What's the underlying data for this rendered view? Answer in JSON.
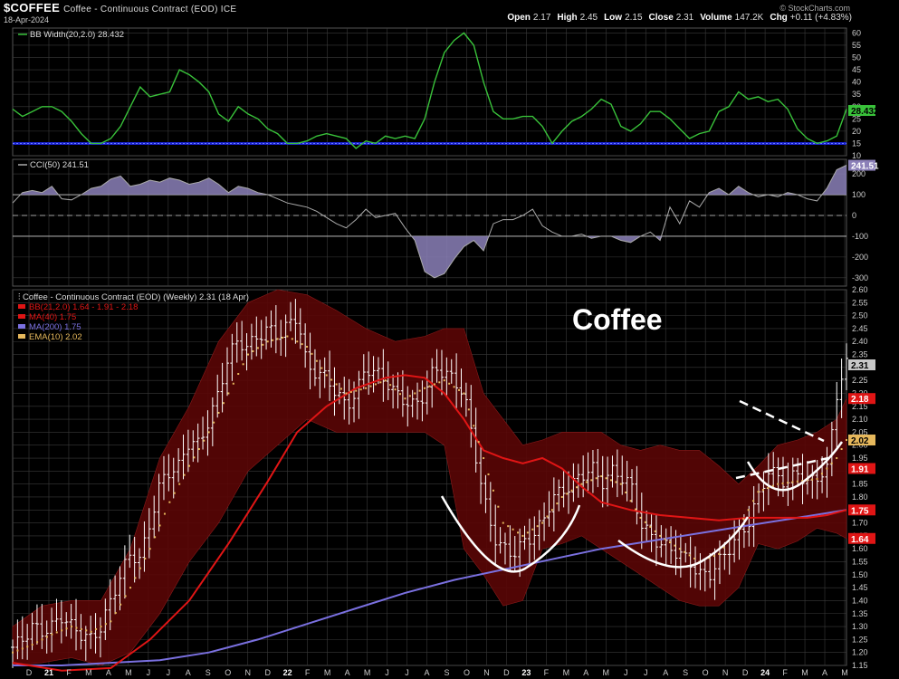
{
  "header": {
    "symbol": "$COFFEE",
    "description": "Coffee - Continuous Contract (EOD) ICE",
    "date": "18-Apr-2024",
    "copyright": "© StockCharts.com",
    "ohlc": [
      {
        "label": "Open",
        "value": "2.17"
      },
      {
        "label": "High",
        "value": "2.45"
      },
      {
        "label": "Low",
        "value": "2.15"
      },
      {
        "label": "Close",
        "value": "2.31"
      },
      {
        "label": "Volume",
        "value": "147.2K"
      },
      {
        "label": "Chg",
        "value": "+0.11 (+4.83%)"
      }
    ]
  },
  "colors": {
    "background": "#000000",
    "grid": "#3a3a3a",
    "bbwidth": "#39c23a",
    "bbwidth_ref": "#1a22cc",
    "cci_line": "#aaaaaa",
    "cci_fill": "#8b80b8",
    "band_fill": "#5a0505",
    "ma40": "#e01515",
    "ma200": "#7a70e0",
    "ema10": "#e6b85c",
    "bars": "#ffffff",
    "annot": "#ffffff",
    "label_box": "#c8c8c8"
  },
  "chart_data": [
    {
      "type": "line",
      "title": "BB Width(20,2.0) 28.432",
      "current_label": "28.432",
      "ylim": [
        10,
        62
      ],
      "yticks": [
        "10",
        "15",
        "20",
        "25",
        "30",
        "35",
        "40",
        "45",
        "50",
        "55",
        "60"
      ],
      "reference_line": 15,
      "x": [
        0,
        2,
        4,
        6,
        8,
        10,
        12,
        14,
        16,
        18,
        20,
        22,
        24,
        26,
        28,
        30,
        32,
        34,
        36,
        38,
        40,
        42,
        44,
        46,
        48,
        50,
        52,
        54,
        56,
        58,
        60,
        62,
        64,
        66,
        68,
        70,
        72,
        74,
        76,
        78,
        80,
        82,
        84,
        86,
        88,
        90,
        92,
        94,
        96,
        98,
        100,
        102,
        104,
        106,
        108,
        110,
        112,
        114,
        116,
        118,
        120,
        122,
        124,
        126,
        128,
        130,
        132,
        134,
        136,
        138,
        140,
        142,
        144,
        146,
        148,
        150,
        152,
        154,
        156,
        158,
        160,
        162,
        164,
        166,
        168,
        170
      ],
      "values": [
        29,
        26,
        28,
        30,
        30,
        28,
        24,
        19,
        15,
        15,
        17,
        22,
        30,
        38,
        34,
        35,
        36,
        45,
        43,
        40,
        36,
        27,
        24,
        30,
        27,
        25,
        21,
        19,
        15,
        15,
        16,
        18,
        19,
        18,
        17,
        13,
        16,
        15,
        18,
        17,
        18,
        17,
        25,
        40,
        52,
        57,
        60,
        55,
        40,
        28,
        25,
        25,
        26,
        26,
        22,
        15,
        20,
        24,
        26,
        29,
        33,
        31,
        22,
        20,
        23,
        28,
        28,
        25,
        21,
        17,
        19,
        20,
        28,
        30,
        36,
        33,
        34,
        32,
        33,
        29,
        21,
        17,
        15,
        16,
        18,
        29
      ],
      "series": [
        {
          "name": "BB Width(20,2.0)"
        }
      ]
    },
    {
      "type": "line",
      "title": "CCI(50) 241.51",
      "current_label": "241.51",
      "ylim": [
        -340,
        270
      ],
      "yticks": [
        "-300",
        "-200",
        "-100",
        "0",
        "100",
        "200"
      ],
      "hlines": [
        100,
        0,
        -100
      ],
      "x": [
        0,
        2,
        4,
        6,
        8,
        10,
        12,
        14,
        16,
        18,
        20,
        22,
        24,
        26,
        28,
        30,
        32,
        34,
        36,
        38,
        40,
        42,
        44,
        46,
        48,
        50,
        52,
        54,
        56,
        58,
        60,
        62,
        64,
        66,
        68,
        70,
        72,
        74,
        76,
        78,
        80,
        82,
        84,
        86,
        88,
        90,
        92,
        94,
        96,
        98,
        100,
        102,
        104,
        106,
        108,
        110,
        112,
        114,
        116,
        118,
        120,
        122,
        124,
        126,
        128,
        130,
        132,
        134,
        136,
        138,
        140,
        142,
        144,
        146,
        148,
        150,
        152,
        154,
        156,
        158,
        160,
        162,
        164,
        166,
        168,
        170
      ],
      "values": [
        60,
        110,
        120,
        110,
        140,
        80,
        75,
        100,
        130,
        140,
        175,
        190,
        140,
        150,
        170,
        160,
        180,
        170,
        150,
        160,
        180,
        150,
        110,
        140,
        130,
        110,
        100,
        80,
        60,
        50,
        40,
        20,
        -10,
        -40,
        -60,
        -20,
        30,
        -10,
        0,
        10,
        -60,
        -120,
        -270,
        -300,
        -280,
        -210,
        -150,
        -120,
        -170,
        -40,
        -20,
        -20,
        0,
        30,
        -50,
        -80,
        -100,
        -100,
        -90,
        -110,
        -100,
        -100,
        -120,
        -130,
        -100,
        -80,
        -120,
        40,
        -40,
        70,
        40,
        110,
        130,
        100,
        140,
        110,
        90,
        100,
        90,
        110,
        100,
        80,
        70,
        130,
        220,
        241.51
      ],
      "series": [
        {
          "name": "CCI(50)"
        }
      ]
    },
    {
      "type": "candlestick",
      "title": "Coffee - Continuous Contract (EOD) (Weekly) 2.31 (18 Apr)",
      "annotation": "Coffee",
      "ylim": [
        1.15,
        2.6
      ],
      "yticks": [
        "1.15",
        "1.20",
        "1.25",
        "1.30",
        "1.35",
        "1.40",
        "1.45",
        "1.50",
        "1.55",
        "1.60",
        "1.65",
        "1.70",
        "1.75",
        "1.80",
        "1.85",
        "1.90",
        "1.95",
        "2.00",
        "2.05",
        "2.10",
        "2.15",
        "2.20",
        "2.25",
        "2.30",
        "2.35",
        "2.40",
        "2.45",
        "2.50",
        "2.55",
        "2.60"
      ],
      "xticks": [
        "D",
        "21",
        "F",
        "M",
        "A",
        "M",
        "J",
        "J",
        "A",
        "S",
        "O",
        "N",
        "D",
        "22",
        "F",
        "M",
        "A",
        "M",
        "J",
        "J",
        "A",
        "S",
        "O",
        "N",
        "D",
        "23",
        "F",
        "M",
        "A",
        "M",
        "J",
        "J",
        "A",
        "S",
        "O",
        "N",
        "D",
        "24",
        "F",
        "M",
        "A",
        "M"
      ],
      "legend": [
        {
          "name": "BB(21,2.0)",
          "value": "1.64 - 1.91 - 2.18",
          "color": "#e01515"
        },
        {
          "name": "MA(40)",
          "value": "1.75",
          "color": "#e01515"
        },
        {
          "name": "MA(200)",
          "value": "1.75",
          "color": "#7a70e0"
        },
        {
          "name": "EMA(10)",
          "value": "2.02",
          "color": "#e6b85c"
        }
      ],
      "right_labels": [
        {
          "text": "2.31",
          "value": 2.31,
          "color": "#c8c8c8"
        },
        {
          "text": "2.18",
          "value": 2.18,
          "color": "#e01515"
        },
        {
          "text": "2.02",
          "value": 2.02,
          "color": "#e6b85c"
        },
        {
          "text": "1.91",
          "value": 1.91,
          "color": "#e01515"
        },
        {
          "text": "1.75",
          "value": 1.75,
          "color": "#e01515"
        },
        {
          "text": "1.64",
          "value": 1.64,
          "color": "#e01515"
        }
      ],
      "close": {
        "x": [
          0,
          2,
          4,
          6,
          8,
          10,
          12,
          14,
          16,
          18,
          20,
          22,
          24,
          26,
          28,
          30,
          32,
          34,
          36,
          38,
          40,
          42,
          44,
          46,
          48,
          50,
          52,
          54,
          56,
          58,
          60,
          62,
          64,
          66,
          68,
          70,
          72,
          74,
          76,
          78,
          80,
          82,
          84,
          86,
          88,
          90,
          92,
          94,
          96,
          98,
          100,
          102,
          104,
          106,
          108,
          110,
          112,
          114,
          116,
          118,
          120,
          122,
          124,
          126,
          128,
          130,
          132,
          134,
          136,
          138,
          140,
          142,
          144,
          146,
          148,
          150,
          152,
          154,
          156,
          158,
          160,
          162,
          164,
          166,
          168,
          170
        ],
        "values": [
          1.22,
          1.25,
          1.3,
          1.28,
          1.3,
          1.34,
          1.3,
          1.27,
          1.25,
          1.3,
          1.4,
          1.5,
          1.58,
          1.56,
          1.7,
          1.85,
          1.9,
          1.92,
          2.02,
          2.0,
          2.1,
          2.2,
          2.35,
          2.4,
          2.38,
          2.42,
          2.45,
          2.42,
          2.46,
          2.5,
          2.3,
          2.28,
          2.26,
          2.2,
          2.15,
          2.2,
          2.3,
          2.28,
          2.25,
          2.2,
          2.17,
          2.15,
          2.2,
          2.3,
          2.28,
          2.25,
          2.2,
          2.0,
          1.8,
          1.65,
          1.6,
          1.58,
          1.62,
          1.65,
          1.7,
          1.8,
          1.82,
          1.85,
          1.88,
          1.92,
          1.85,
          1.9,
          1.88,
          1.85,
          1.7,
          1.65,
          1.62,
          1.6,
          1.58,
          1.55,
          1.5,
          1.5,
          1.55,
          1.6,
          1.65,
          1.7,
          1.8,
          1.9,
          1.88,
          1.85,
          1.9,
          1.85,
          1.88,
          1.9,
          2.2,
          2.31
        ]
      },
      "ma40": {
        "x": [
          0,
          10,
          20,
          28,
          36,
          44,
          52,
          58,
          64,
          70,
          76,
          80,
          84,
          88,
          92,
          96,
          100,
          104,
          108,
          112,
          116,
          120,
          126,
          132,
          138,
          144,
          150,
          156,
          162,
          166,
          170
        ],
        "values": [
          1.16,
          1.13,
          1.14,
          1.25,
          1.4,
          1.62,
          1.86,
          2.05,
          2.15,
          2.22,
          2.26,
          2.27,
          2.26,
          2.2,
          2.1,
          1.98,
          1.95,
          1.93,
          1.95,
          1.91,
          1.84,
          1.78,
          1.75,
          1.73,
          1.72,
          1.71,
          1.72,
          1.72,
          1.72,
          1.73,
          1.75
        ]
      },
      "ma200": {
        "x": [
          0,
          10,
          20,
          30,
          40,
          50,
          60,
          70,
          80,
          90,
          100,
          110,
          120,
          130,
          140,
          150,
          160,
          170
        ],
        "values": [
          1.15,
          1.15,
          1.16,
          1.17,
          1.2,
          1.25,
          1.31,
          1.37,
          1.43,
          1.48,
          1.52,
          1.56,
          1.6,
          1.63,
          1.66,
          1.69,
          1.72,
          1.75
        ]
      },
      "ema10": {
        "x": [
          0,
          4,
          8,
          12,
          16,
          20,
          24,
          28,
          32,
          36,
          40,
          44,
          48,
          52,
          56,
          60,
          64,
          68,
          72,
          76,
          80,
          84,
          88,
          92,
          96,
          100,
          104,
          108,
          112,
          116,
          120,
          124,
          128,
          132,
          136,
          140,
          144,
          148,
          152,
          156,
          160,
          164,
          168,
          170
        ],
        "values": [
          1.2,
          1.23,
          1.27,
          1.3,
          1.28,
          1.32,
          1.45,
          1.6,
          1.78,
          1.92,
          2.05,
          2.2,
          2.35,
          2.4,
          2.42,
          2.38,
          2.27,
          2.2,
          2.22,
          2.25,
          2.18,
          2.22,
          2.25,
          2.2,
          1.95,
          1.7,
          1.65,
          1.7,
          1.8,
          1.85,
          1.88,
          1.85,
          1.72,
          1.65,
          1.6,
          1.55,
          1.58,
          1.68,
          1.82,
          1.85,
          1.86,
          1.87,
          1.95,
          2.02
        ]
      },
      "bb_upper": {
        "x": [
          0,
          6,
          12,
          18,
          24,
          30,
          36,
          42,
          48,
          54,
          60,
          66,
          72,
          78,
          84,
          88,
          92,
          96,
          100,
          104,
          108,
          112,
          116,
          120,
          124,
          128,
          132,
          136,
          140,
          144,
          148,
          152,
          156,
          160,
          164,
          168,
          170
        ],
        "values": [
          1.3,
          1.38,
          1.4,
          1.4,
          1.6,
          1.95,
          2.15,
          2.4,
          2.55,
          2.6,
          2.58,
          2.52,
          2.45,
          2.4,
          2.42,
          2.45,
          2.45,
          2.2,
          2.1,
          2.0,
          2.02,
          2.05,
          2.05,
          2.05,
          2.0,
          1.98,
          2.0,
          1.98,
          1.98,
          1.92,
          1.85,
          1.92,
          2.0,
          2.02,
          2.05,
          2.1,
          2.18
        ]
      },
      "bb_lower": {
        "x": [
          0,
          6,
          12,
          18,
          24,
          30,
          36,
          42,
          48,
          54,
          60,
          66,
          72,
          78,
          84,
          88,
          92,
          96,
          100,
          104,
          108,
          112,
          116,
          120,
          124,
          128,
          132,
          136,
          140,
          144,
          148,
          152,
          156,
          160,
          164,
          168,
          170
        ],
        "values": [
          1.15,
          1.16,
          1.18,
          1.15,
          1.2,
          1.35,
          1.55,
          1.7,
          1.9,
          2.0,
          2.1,
          2.05,
          2.05,
          2.05,
          2.05,
          2.0,
          1.6,
          1.5,
          1.38,
          1.4,
          1.6,
          1.62,
          1.65,
          1.6,
          1.55,
          1.5,
          1.45,
          1.4,
          1.38,
          1.38,
          1.45,
          1.62,
          1.6,
          1.63,
          1.68,
          1.66,
          1.64
        ]
      }
    }
  ]
}
